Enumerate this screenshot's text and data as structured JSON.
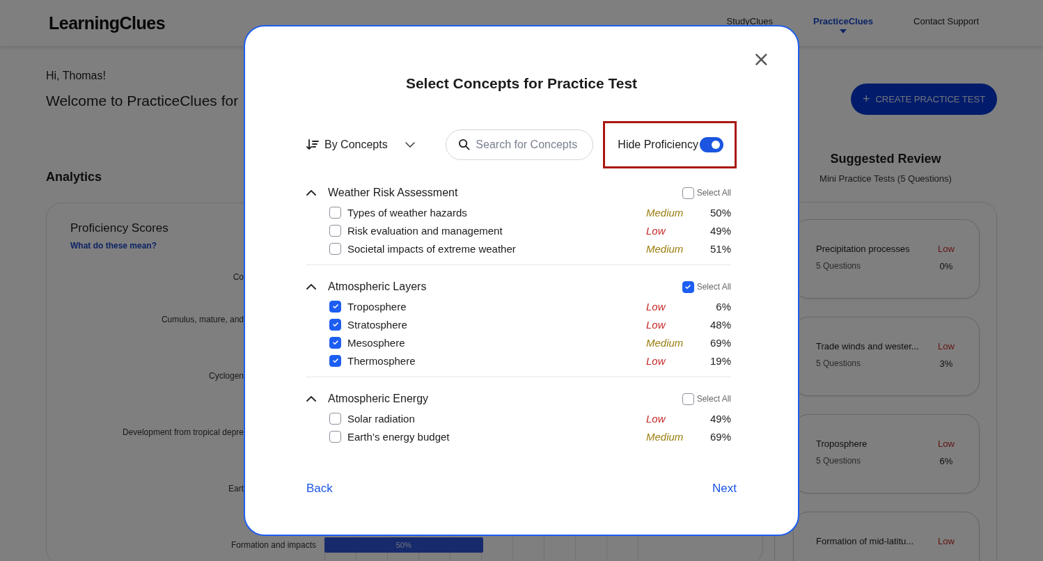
{
  "header": {
    "logo": "LearningClues",
    "nav": [
      {
        "label": "StudyClues",
        "selected": false
      },
      {
        "label": "PracticeClues",
        "selected": true
      },
      {
        "label": "Contact Support",
        "selected": false
      }
    ]
  },
  "greeting": "Hi, Thomas!",
  "welcome": "Welcome to PracticeClues for",
  "create_button": {
    "icon": "+",
    "label": "CREATE PRACTICE TEST"
  },
  "analytics": {
    "title": "Analytics",
    "card_title": "Proficiency Scores",
    "help_link": "What do these mean?",
    "rows": [
      {
        "label": "Co"
      },
      {
        "label": "Cumulus, mature, and"
      },
      {
        "label": "Cyclogen"
      },
      {
        "label": "Development from tropical depre"
      },
      {
        "label": "Eart"
      },
      {
        "label": "Formation and impacts",
        "bar": {
          "level": 0.5,
          "label": "50%"
        }
      }
    ]
  },
  "suggested": {
    "title": "Suggested Review",
    "subtitle": "Mini Practice Tests (5 Questions)",
    "cards": [
      {
        "title": "Precipitation processes",
        "level_label": "Low",
        "questions": "5 Questions",
        "percent": "0%"
      },
      {
        "title": "Trade winds and wester...",
        "level_label": "Low",
        "questions": "5 Questions",
        "percent": "3%"
      },
      {
        "title": "Troposphere",
        "level_label": "Low",
        "questions": "5 Questions",
        "percent": "6%"
      },
      {
        "title": "Formation of mid-latitu...",
        "level_label": "Low"
      }
    ]
  },
  "modal": {
    "close": "×",
    "title": "Select Concepts for Practice Test",
    "sort": {
      "value": "By Concepts"
    },
    "search": {
      "placeholder": "Search for Concepts"
    },
    "hide_proficiency": {
      "label": "Hide Proficiency",
      "on": true,
      "highlighted": true
    },
    "groups": [
      {
        "title": "Weather Risk Assessment",
        "expanded": true,
        "select_all": {
          "label": "Select All",
          "checked": false
        },
        "items": [
          {
            "label": "Types of weather hazards",
            "checked": false,
            "level": "Medium",
            "percent": "50%"
          },
          {
            "label": "Risk evaluation and management",
            "checked": false,
            "level": "Low",
            "percent": "49%"
          },
          {
            "label": "Societal impacts of extreme weather",
            "checked": false,
            "level": "Medium",
            "percent": "51%"
          }
        ]
      },
      {
        "title": "Atmospheric Layers",
        "expanded": true,
        "select_all": {
          "label": "Select All",
          "checked": true
        },
        "items": [
          {
            "label": "Troposphere",
            "checked": true,
            "level": "Low",
            "percent": "6%"
          },
          {
            "label": "Stratosphere",
            "checked": true,
            "level": "Low",
            "percent": "48%"
          },
          {
            "label": "Mesosphere",
            "checked": true,
            "level": "Medium",
            "percent": "69%"
          },
          {
            "label": "Thermosphere",
            "checked": true,
            "level": "Low",
            "percent": "19%"
          }
        ]
      },
      {
        "title": "Atmospheric Energy",
        "expanded": true,
        "select_all": {
          "label": "Select All",
          "checked": false
        },
        "items": [
          {
            "label": "Solar radiation",
            "checked": false,
            "level": "Low",
            "percent": "49%"
          },
          {
            "label": "Earth’s energy budget",
            "checked": false,
            "level": "Medium",
            "percent": "69%"
          }
        ]
      }
    ],
    "back": "Back",
    "next": "Next"
  }
}
